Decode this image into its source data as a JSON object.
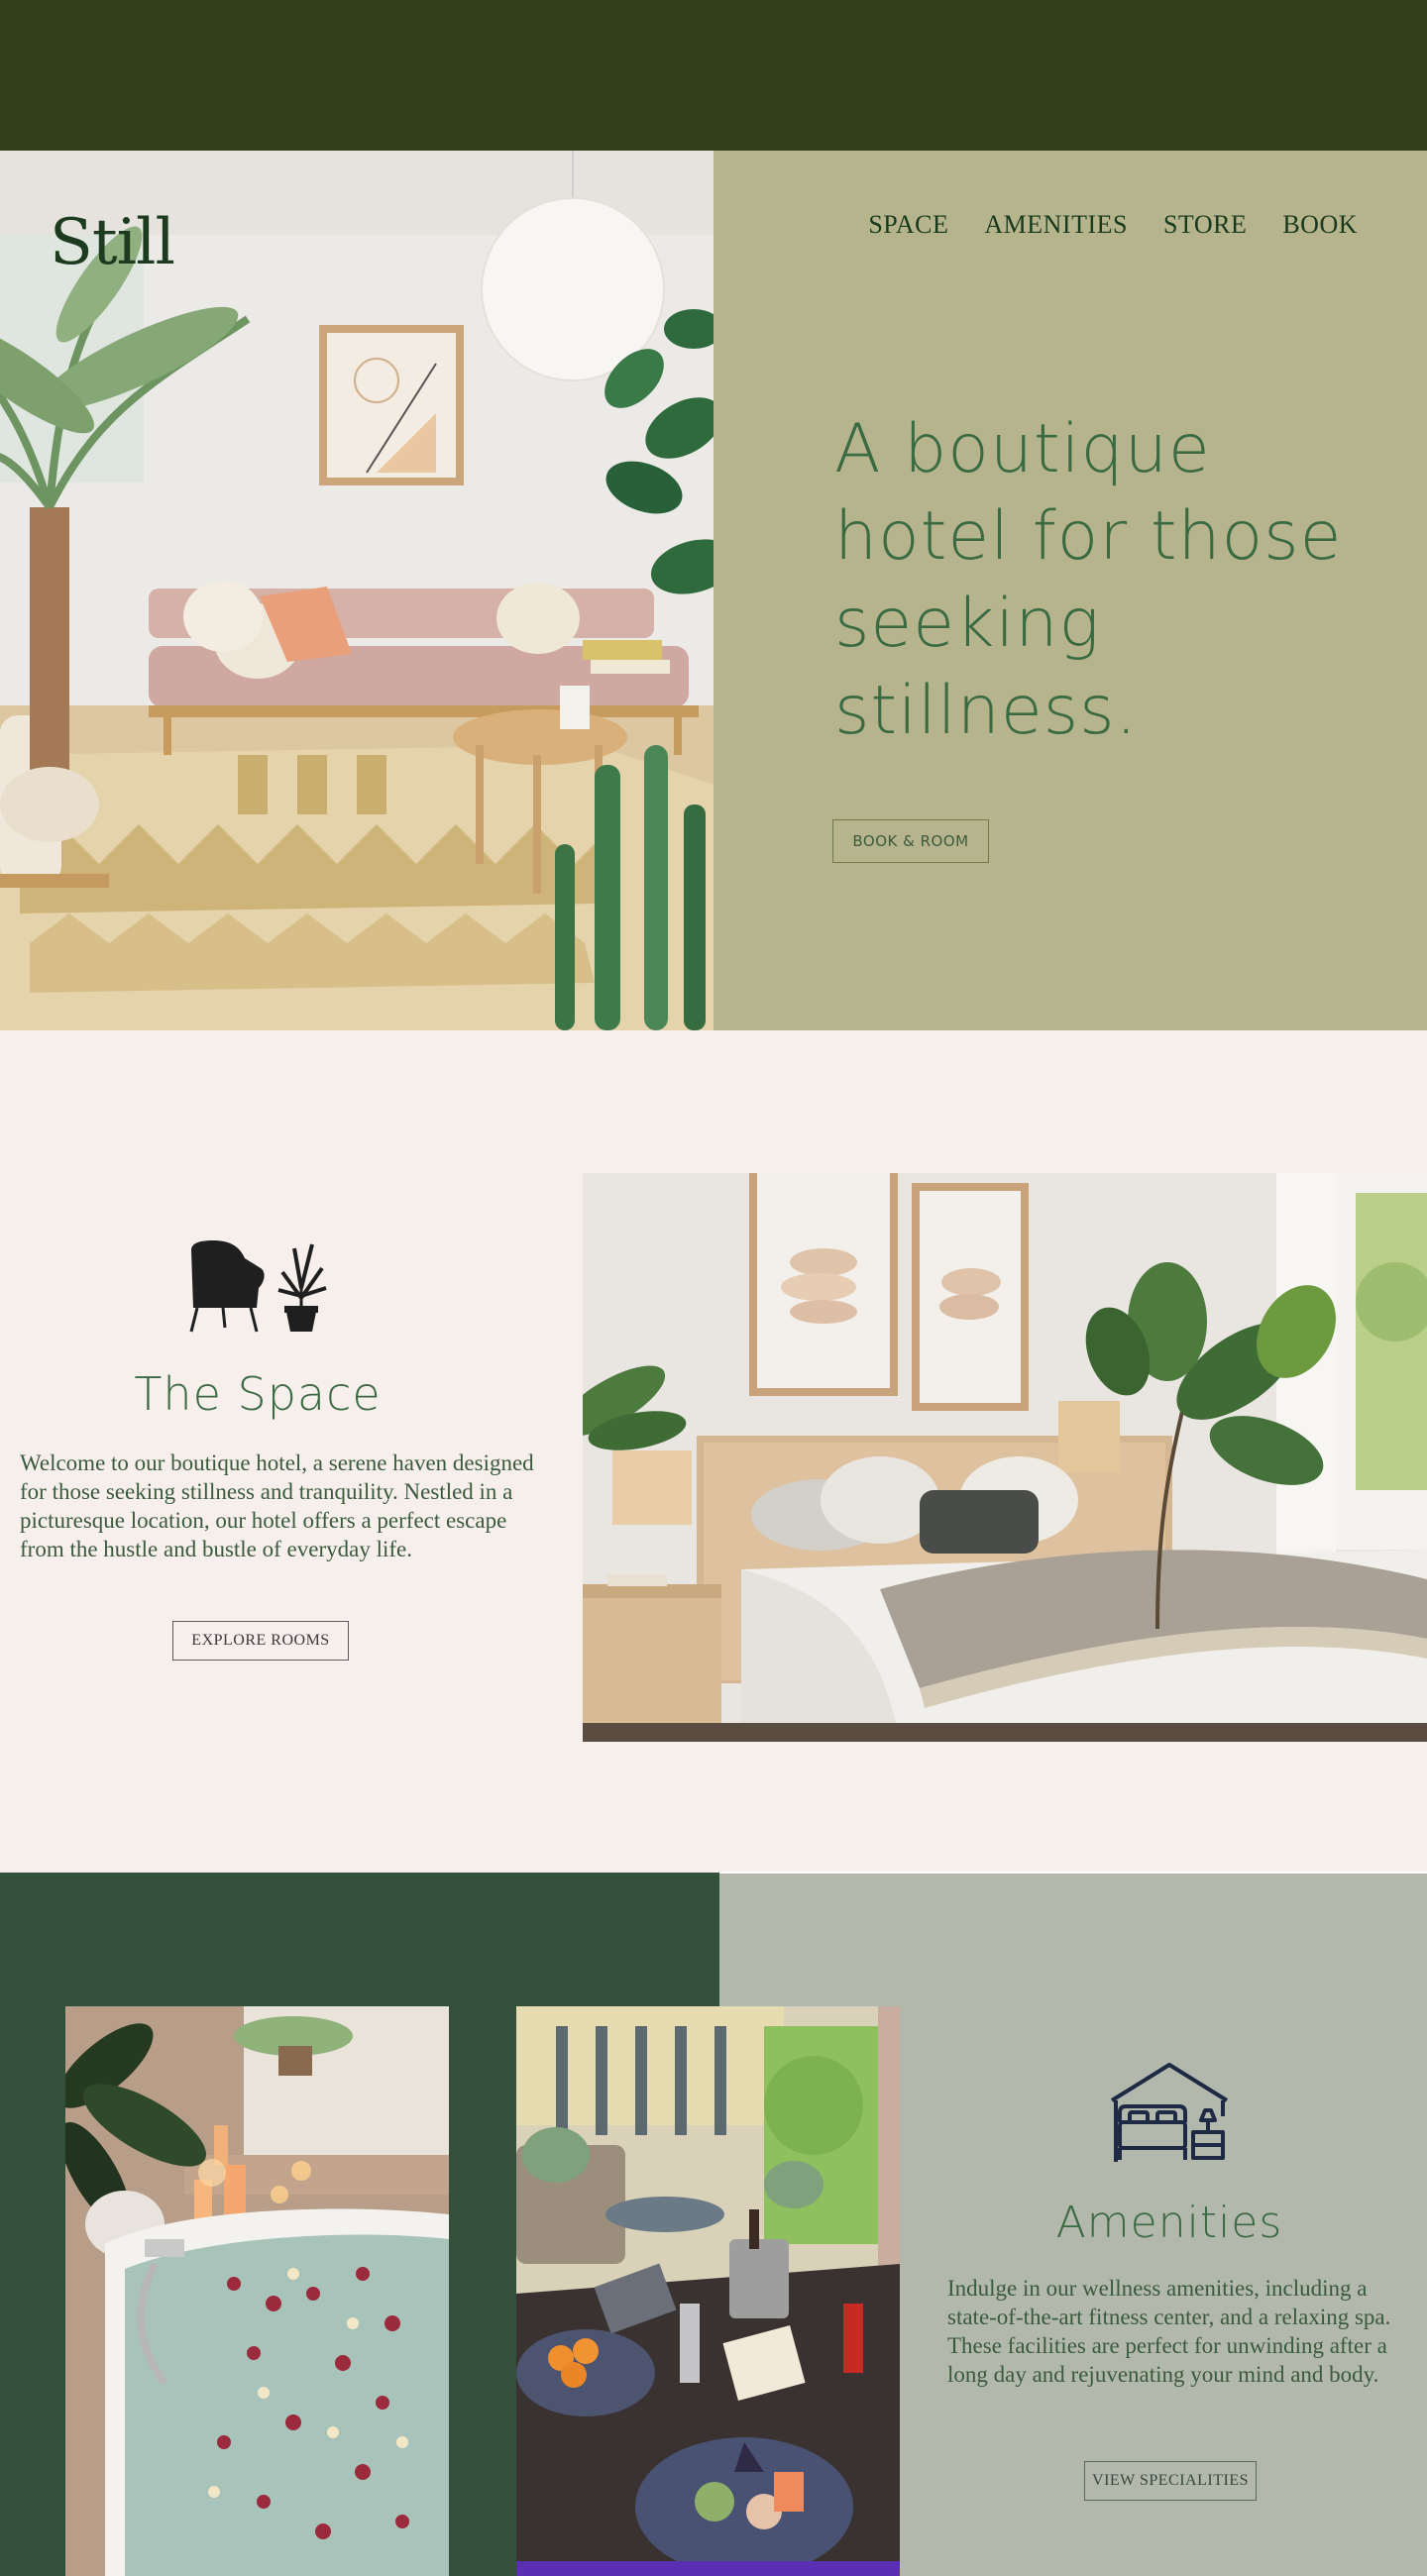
{
  "brand": {
    "name": "Still"
  },
  "nav": {
    "items": [
      "SPACE",
      "AMENITIES",
      "STORE",
      "BOOK"
    ]
  },
  "hero": {
    "headline": "A boutique hotel for those seeking stillness.",
    "cta": "BOOK & ROOM"
  },
  "space": {
    "title": "The Space",
    "text": "Welcome to our boutique hotel, a serene haven designed for those seeking stillness and tranquility. Nestled in a picturesque location, our hotel offers a perfect escape from the hustle and bustle of everyday life.",
    "cta": "EXPLORE ROOMS",
    "icon": "armchair-plant-icon"
  },
  "amenities": {
    "title": "Amenities",
    "text": "Indulge in our wellness amenities, including a state-of-the-art fitness center, and a relaxing spa. These facilities are perfect for unwinding after a long day and rejuvenating your mind and body.",
    "cta": "VIEW SPECIALITIES",
    "icon": "house-bed-icon"
  },
  "colors": {
    "topbar": "#313f1b",
    "hero_panel": "#b6b48d",
    "page_bg": "#f7efeb",
    "amenities_dark": "#33503a",
    "amenities_light": "#b3b8ad",
    "accent_green": "#3a6a42"
  }
}
